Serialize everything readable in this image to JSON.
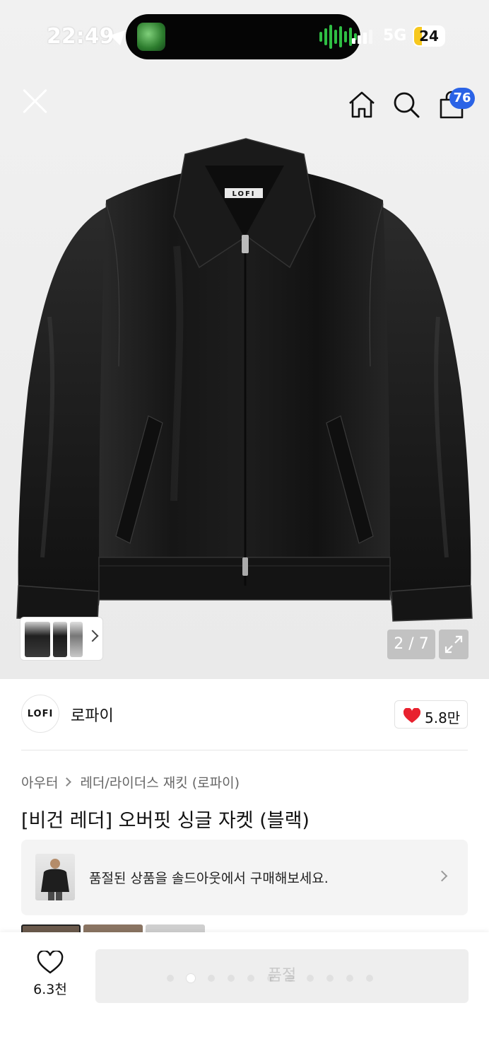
{
  "status_bar": {
    "time": "22:49",
    "network": "5G",
    "battery": "24"
  },
  "header": {
    "cart_badge": "76"
  },
  "gallery": {
    "counter": "2 / 7"
  },
  "brand": {
    "logo_text": "LOFI",
    "name": "로파이",
    "likes": "5.8만"
  },
  "product": {
    "breadcrumb": [
      "아우터",
      "레더/라이더스 재킷 (로파이)"
    ],
    "title": "[비건 레더] 오버핏 싱글 자켓 (블랙)",
    "jacket_label": "LOFI"
  },
  "soldout_banner": {
    "text": "품절된 상품을 솔드아웃에서 구매해보세요."
  },
  "bottom_bar": {
    "wish_count": "6.3천",
    "buy_label": "품절"
  },
  "icons": {
    "close": "close-icon",
    "home": "home-icon",
    "search": "search-icon",
    "cart": "cart-icon",
    "expand": "expand-icon",
    "heart": "heart-icon"
  },
  "colors": {
    "accent_blue": "#2b63e6",
    "like_red": "#e8212e"
  }
}
